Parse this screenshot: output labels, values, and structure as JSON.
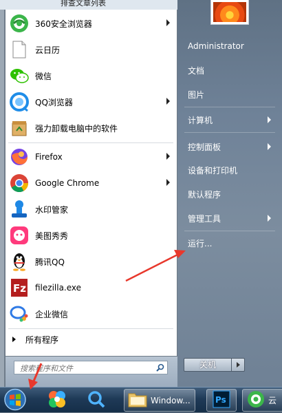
{
  "background": {
    "title_fragment": "排查文章列表"
  },
  "programs": [
    {
      "label": "360安全浏览器",
      "icon": "360-browser-icon",
      "has_submenu": true
    },
    {
      "label": "云日历",
      "icon": "calendar-doc-icon",
      "has_submenu": false
    },
    {
      "label": "微信",
      "icon": "wechat-icon",
      "has_submenu": false
    },
    {
      "label": "QQ浏览器",
      "icon": "qq-browser-icon",
      "has_submenu": true
    },
    {
      "label": "强力卸载电脑中的软件",
      "icon": "uninstaller-icon",
      "has_submenu": false
    },
    {
      "label": "Firefox",
      "icon": "firefox-icon",
      "has_submenu": true
    },
    {
      "label": "Google Chrome",
      "icon": "chrome-icon",
      "has_submenu": true
    },
    {
      "label": "水印管家",
      "icon": "watermark-manager-icon",
      "has_submenu": false
    },
    {
      "label": "美图秀秀",
      "icon": "meitu-icon",
      "has_submenu": false
    },
    {
      "label": "腾讯QQ",
      "icon": "qq-penguin-icon",
      "has_submenu": false
    },
    {
      "label": "filezilla.exe",
      "icon": "filezilla-icon",
      "has_submenu": false
    },
    {
      "label": "企业微信",
      "icon": "wecom-icon",
      "has_submenu": false
    }
  ],
  "all_programs": "所有程序",
  "search": {
    "placeholder": "搜索程序和文件"
  },
  "right_menu": [
    {
      "label": "Administrator",
      "has_submenu": false
    },
    {
      "label": "文档",
      "has_submenu": false
    },
    {
      "label": "图片",
      "has_submenu": false
    },
    {
      "label": "计算机",
      "has_submenu": true
    },
    {
      "label": "控制面板",
      "has_submenu": true
    },
    {
      "label": "设备和打印机",
      "has_submenu": false
    },
    {
      "label": "默认程序",
      "has_submenu": false
    },
    {
      "label": "管理工具",
      "has_submenu": true
    },
    {
      "label": "运行...",
      "has_submenu": false
    }
  ],
  "shutdown": {
    "label": "关机"
  },
  "taskbar": {
    "items": [
      {
        "label": "",
        "icon": "windows-start-orb-icon"
      },
      {
        "label": "",
        "icon": "pinwheel-app-icon"
      },
      {
        "label": "",
        "icon": "search-app-icon"
      },
      {
        "label": "Window...",
        "icon": "folder-icon"
      },
      {
        "label": "",
        "icon": "photoshop-icon"
      },
      {
        "label": "云",
        "icon": "360-browser-icon"
      }
    ]
  },
  "colors": {
    "annotation_arrow": "#e8382c",
    "menu_right_bg": "#6f8298",
    "taskbar_bg": "#1f3a57"
  }
}
